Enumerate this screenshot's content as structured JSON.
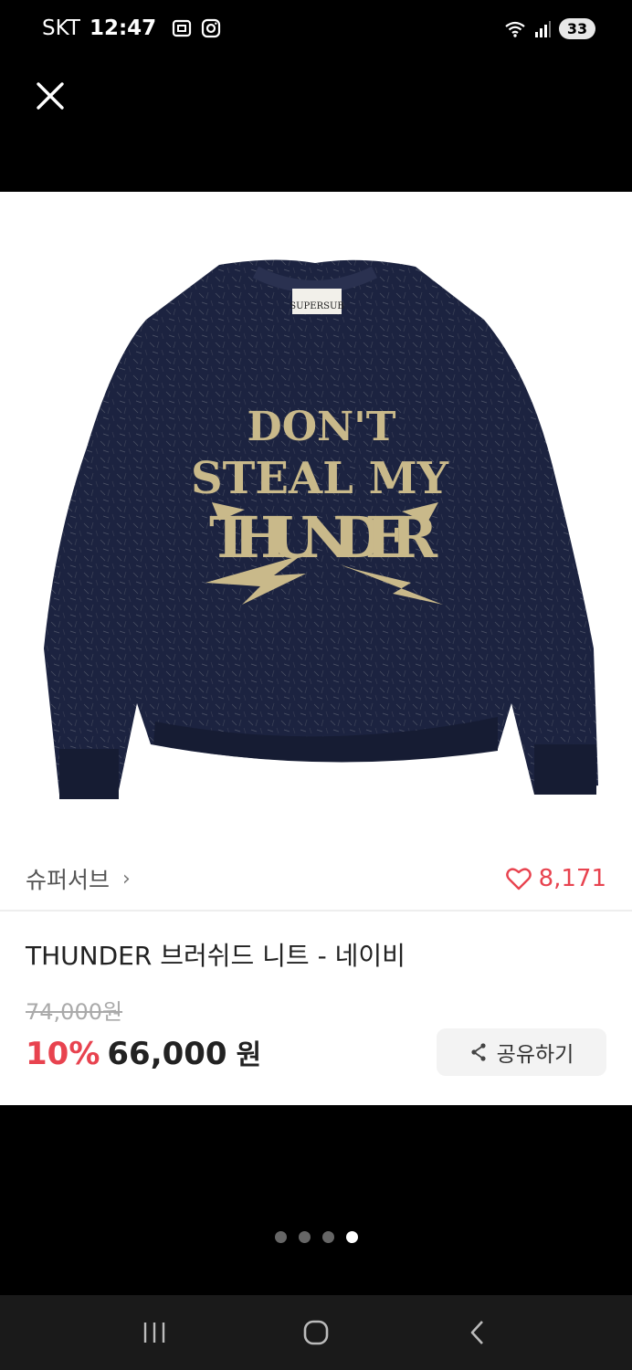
{
  "status_bar": {
    "carrier": "SKT",
    "time": "12:47",
    "battery": "33"
  },
  "product": {
    "brand": "슈퍼서브",
    "likes": "8,171",
    "title": "THUNDER 브러쉬드 니트 - 네이비",
    "original_price": "74,000원",
    "discount": "10%",
    "price": "66,000",
    "currency": "원",
    "image_text": [
      "DON'T",
      "STEAL MY",
      "THUNDER"
    ],
    "neck_label": "SUPERSUB"
  },
  "actions": {
    "share_label": "공유하기"
  },
  "carousel": {
    "total": 4,
    "active_index": 3
  },
  "colors": {
    "accent": "#e8434f",
    "sweater": "#1c2340",
    "print": "#c9b98a"
  }
}
